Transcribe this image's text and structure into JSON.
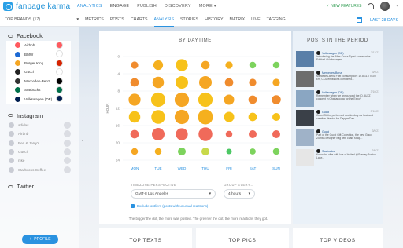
{
  "app": {
    "logo_text": "fanpage karma",
    "main_nav": [
      "ANALYTICS",
      "ENGAGE",
      "PUBLISH",
      "DISCOVERY",
      "MORE"
    ],
    "new_features": "✓ NEW FEATURES",
    "more_caret": "▾"
  },
  "subbar": {
    "brands_label": "TOP BRANDS (17)",
    "tabs": [
      "METRICS",
      "POSTS",
      "CHARTS",
      "ANALYSIS",
      "STORIES",
      "HISTORY",
      "MATRIX",
      "LIVE",
      "TAGGING"
    ],
    "active_tab": "ANALYSIS",
    "date_range": "LAST 28 DAYS"
  },
  "sidebar": {
    "facebook_title": "Facebook",
    "facebook_brands": [
      {
        "name": "Airbnb",
        "logo": "#ff5a5f",
        "dot": "#ff5a5f"
      },
      {
        "name": "BMW",
        "logo": "#1c69d4",
        "dot": "#ffffff"
      },
      {
        "name": "Burger King",
        "logo": "#f5a623",
        "dot": "#d62300"
      },
      {
        "name": "Gucci",
        "logo": "#222222",
        "dot": "#ffffff"
      },
      {
        "name": "Mercedes-Benz",
        "logo": "#333333",
        "dot": "#000000"
      },
      {
        "name": "Starbucks",
        "logo": "#00704a",
        "dot": "#00704a"
      },
      {
        "name": "Volkswagen (DE)",
        "logo": "#001e50",
        "dot": "#001e50"
      }
    ],
    "instagram_title": "Instagram",
    "instagram_brands": [
      {
        "name": "adidas"
      },
      {
        "name": "Airbnb"
      },
      {
        "name": "Ben & Jerry's"
      },
      {
        "name": "Gucci"
      },
      {
        "name": "nike"
      },
      {
        "name": "Starbucks Coffee"
      }
    ],
    "twitter_title": "Twitter",
    "profile_button": "PROFILE"
  },
  "daytime_card": {
    "title": "BY DAYTIME",
    "timezone_label": "TIMEZONE PERSPECTIVE",
    "timezone_value": "GMT-8 Los Angeles",
    "group_label": "GROUP EVERY...",
    "group_value": "4 hours",
    "exclude_label": "Exclude outliers (posts with unusual reactions)",
    "note": "The bigger the dot, the more was posted. The greener the dot, the more reactions they got."
  },
  "chart_data": {
    "type": "scatter",
    "title": "BY DAYTIME",
    "ylabel": "HOUR",
    "y_ticks": [
      0,
      4,
      8,
      12,
      16,
      20,
      24
    ],
    "x_categories": [
      "MON",
      "TUE",
      "WED",
      "THU",
      "FRI",
      "SAT",
      "SUN"
    ],
    "y_rows": [
      2,
      6,
      10,
      14,
      18,
      22
    ],
    "size_scale": "relative post count (0-1)",
    "color_scale": "reactions: orange (low) to green (high)",
    "cells": [
      [
        0.35,
        0.55,
        0.75,
        0.45,
        0.35,
        0.3,
        0.3
      ],
      [
        0.45,
        0.7,
        0.8,
        0.8,
        0.45,
        0.35,
        0.35
      ],
      [
        0.75,
        0.95,
        0.95,
        0.95,
        0.6,
        0.45,
        0.5
      ],
      [
        0.7,
        0.9,
        0.95,
        1.0,
        0.6,
        0.45,
        0.4
      ],
      [
        0.45,
        0.8,
        0.75,
        0.9,
        0.3,
        0.4,
        0.4
      ],
      [
        0.3,
        0.3,
        0.4,
        0.4,
        0.2,
        0.25,
        0.3
      ]
    ],
    "colors": [
      [
        "#f08c2e",
        "#f5b01e",
        "#f7c21a",
        "#f5a623",
        "#f5b01e",
        "#7dd35d",
        "#7dd35d"
      ],
      [
        "#f08c2e",
        "#f5a623",
        "#f7c21a",
        "#f5a623",
        "#f08c2e",
        "#f08c2e",
        "#f5a623"
      ],
      [
        "#f5a623",
        "#f7c21a",
        "#f5a623",
        "#f7c21a",
        "#f5a623",
        "#f08c2e",
        "#f08c2e"
      ],
      [
        "#f7c21a",
        "#f7c21a",
        "#f5a623",
        "#f5b01e",
        "#f7c21a",
        "#f7c21a",
        "#f7c21a"
      ],
      [
        "#f06a5a",
        "#f06a5a",
        "#f06a5a",
        "#f06a5a",
        "#f06a5a",
        "#f06a5a",
        "#f06a5a"
      ],
      [
        "#f5a623",
        "#f5b01e",
        "#7dd35d",
        "#c8d94a",
        "#4cc864",
        "#7dd35d",
        "#7dd35d"
      ]
    ],
    "ylim": [
      0,
      24
    ],
    "grid": true
  },
  "posts_panel": {
    "title": "POSTS IN THE PERIOD",
    "posts": [
      {
        "page": "Volkswagen (DE)",
        "text": "Introducing the Atlas Cross Sport Accessories Edition! #Volkswagen",
        "date": "3/11/21",
        "thumb": "#5a7fa8"
      },
      {
        "page": "Mercedes-Benz",
        "text": "Mercedes-Benz Fuel consumption: 12.8-11.7 l/100 km, CO2 emissions combined...",
        "date": "3/9/21",
        "thumb": "#6d6d6d"
      },
      {
        "page": "Volkswagen (DE)",
        "text": "Remember when we announced the ID.BUZZ concept in Chattanooga for the Expo?",
        "date": "3/10/21",
        "thumb": "#8aa6c2"
      },
      {
        "page": "Gucci",
        "text": "Gucci Stylist performed double duty as host and creative director for Dapper Dan...",
        "date": "3/10/21",
        "thumb": "#3a4048"
      },
      {
        "page": "Gucci",
        "text": "Part of the Gucci Gift Collection, the new Gucci Zumba designer bag with chain strap...",
        "date": "3/9/21",
        "thumb": "#9fb2c8"
      },
      {
        "page": "Starbucks",
        "text": "Know the vibe with lots of fruited @Stanley Boston Lake...",
        "date": "3/9/21",
        "thumb": "#e6e6e6"
      }
    ]
  },
  "bottom_cards": [
    "TOP TEXTS",
    "TOP PICS",
    "TOP VIDEOS"
  ]
}
